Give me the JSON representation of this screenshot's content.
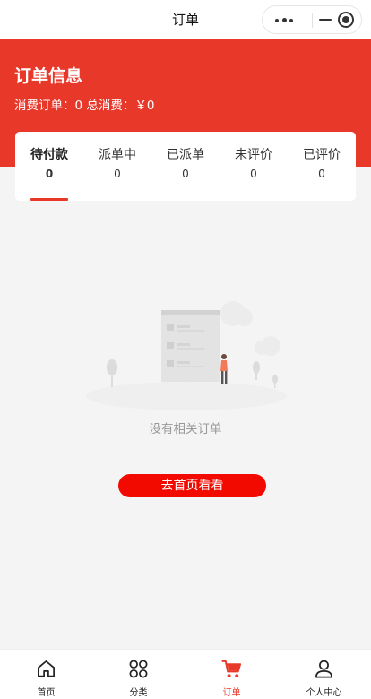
{
  "navbar": {
    "title": "订单"
  },
  "header": {
    "title": "订单信息",
    "summary": "消费订单：0 总消费：￥0"
  },
  "tabs": [
    {
      "label": "待付款",
      "count": "0",
      "active": true
    },
    {
      "label": "派单中",
      "count": "0"
    },
    {
      "label": "已派单",
      "count": "0"
    },
    {
      "label": "未评价",
      "count": "0"
    },
    {
      "label": "已评价",
      "count": "0"
    }
  ],
  "empty": {
    "text": "没有相关订单",
    "button_label": "去首页看看"
  },
  "tabbar": {
    "items": [
      {
        "label": "首页",
        "icon": "home-icon"
      },
      {
        "label": "分类",
        "icon": "grid-icon"
      },
      {
        "label": "订单",
        "icon": "cart-icon",
        "active": true
      },
      {
        "label": "个人中心",
        "icon": "user-icon"
      }
    ]
  },
  "colors": {
    "accent": "#e8382a",
    "button": "#f20a00",
    "background": "#f4f4f4"
  }
}
